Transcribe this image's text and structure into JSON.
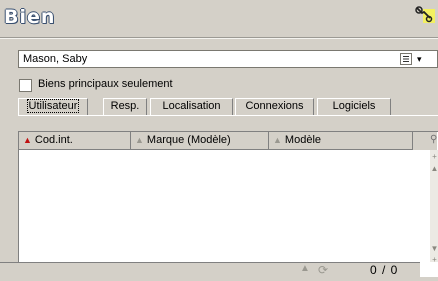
{
  "window": {
    "title": "Bien",
    "tools_icon": "tools-icon"
  },
  "user_combo": {
    "value": "Mason, Saby",
    "detail_icon": "detail-icon",
    "arrow": "▾"
  },
  "filter": {
    "label": "Biens principaux seulement",
    "checked": false
  },
  "tabs": [
    {
      "label": "Utilisateur",
      "active": true
    },
    {
      "label": "Resp.",
      "active": false
    },
    {
      "label": "Localisation",
      "active": false
    },
    {
      "label": "Connexions",
      "active": false
    },
    {
      "label": "Logiciels",
      "active": false
    }
  ],
  "grid": {
    "columns": [
      "Cod.int.",
      "Marque (Modèle)",
      "Modèle"
    ],
    "sort_glyph": "▲",
    "search_icon": "magnifier-icon",
    "rows": []
  },
  "scrollbar": {
    "top_buttons": [
      "+",
      "▲"
    ],
    "bottom_buttons": [
      "▼",
      "+"
    ]
  },
  "status": {
    "up_glyph": "▲",
    "record_count": "0 / 0"
  }
}
